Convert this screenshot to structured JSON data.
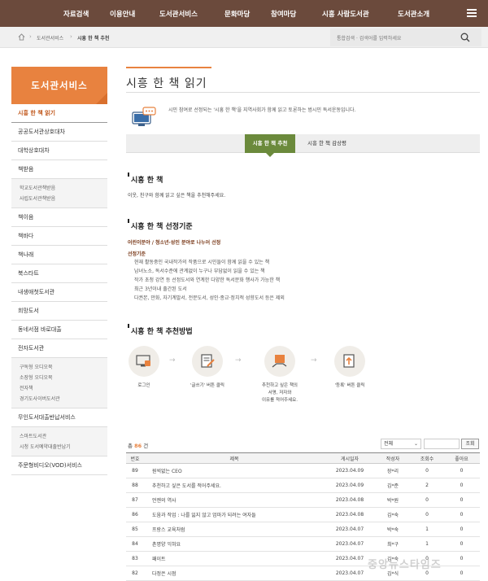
{
  "nav": {
    "items": [
      "자료검색",
      "이용안내",
      "도서관서비스",
      "문화마당",
      "참여마당",
      "시흥 사람도서관",
      "도서관소개"
    ]
  },
  "breadcrumb": {
    "items": [
      "도서관서비스",
      "시흥 한 책 추천"
    ]
  },
  "search": {
    "placeholder": "통합검색 · 검색어를 입력하세요"
  },
  "sidebar": {
    "title": "도서관서비스",
    "items": [
      {
        "label": "시흥 한 책 읽기",
        "active": true
      },
      {
        "label": "공공도서관상호대차"
      },
      {
        "label": "대학상호대차"
      },
      {
        "label": "책받음",
        "sub": [
          "학교도서관책받음",
          "사립도서관책받음"
        ]
      },
      {
        "label": "책이음"
      },
      {
        "label": "책바다"
      },
      {
        "label": "책나래"
      },
      {
        "label": "북스타트"
      },
      {
        "label": "내생애첫도서관"
      },
      {
        "label": "희망도서"
      },
      {
        "label": "동네서점 바로대출"
      },
      {
        "label": "전자도서관",
        "sub": [
          "구독형 오디오북",
          "소장형 오디오북",
          "전자책",
          "경기도사이버도서관"
        ]
      },
      {
        "label": "무인도서대출반납서비스",
        "sub": [
          "스마트도서관",
          "시청 도서예약대출반납기"
        ]
      },
      {
        "label": "주문형비디오(VOD)서비스"
      }
    ]
  },
  "main": {
    "title": "시흥 한 책 읽기",
    "intro": "시민 참여로 선정되는 '시흥 한 책'을 지역사회가 함께 읽고 토론하는 범시민 독서운동입니다.",
    "tabs": [
      "시흥 한 책 추천",
      "시흥 한 책 감상평"
    ],
    "section1": {
      "heading": "시흥 한 책",
      "text": "이웃, 친구와 함께 읽고 싶은 책을 추천해주세요."
    },
    "section2": {
      "heading": "시흥 한 책 선정기준",
      "subheading": "어린이분야 / 청소년·성인 분야로 나누어 선정",
      "criteria_label": "선정기준",
      "criteria": [
        "현재 활동중인 국내작가의 작품으로 시민들이 함께 읽을 수 있는 책",
        "남녀노소, 독서수준에 관계없이 누구나 부담없이 읽을 수 있는 책",
        "작가 초청 강연 등 선정도서와 연계한 다양한 독서문화 행사가 가능한 책",
        "최근 3년이내 출간된 도서",
        "다권본, 만화, 자기계발서, 전문도서, 성인·종교·정치적 성향도서 등은 제외"
      ]
    },
    "section3": {
      "heading": "시흥 한 책 추천방법",
      "steps": [
        {
          "label": "로그인",
          "icon": "login-monitor-icon"
        },
        {
          "label": "'글쓰기' 버튼 클릭",
          "icon": "write-document-icon"
        },
        {
          "label": "추천하고 싶은 책의\n서명, 저자와\n이유를 적어주세요.",
          "icon": "book-hand-icon"
        },
        {
          "label": "'등록' 버튼 클릭",
          "icon": "register-document-icon"
        }
      ]
    },
    "board": {
      "total_label": "총",
      "total_count": "86",
      "total_unit": "건",
      "select_value": "전체",
      "search_button": "조회",
      "columns": [
        "번호",
        "제목",
        "게시일자",
        "작성자",
        "조회수",
        "좋아요"
      ],
      "rows": [
        [
          "89",
          "원씩없는 CEO",
          "2023.04.09",
          "장*리",
          "0",
          "0"
        ],
        [
          "88",
          "추천하고 싶은 도서를 적어주세요.",
          "2023.04.09",
          "김*준",
          "2",
          "0"
        ],
        [
          "87",
          "언젠의 역사",
          "2023.04.08",
          "박*원",
          "0",
          "0"
        ],
        [
          "86",
          "도움과 작업 : 나를 잃지 않고 엄마가 되려는 여자들",
          "2023.04.08",
          "김*숙",
          "0",
          "0"
        ],
        [
          "85",
          "프랑스 교육처럼",
          "2023.04.07",
          "박*숙",
          "1",
          "0"
        ],
        [
          "84",
          "촌명양 익혀요",
          "2023.04.07",
          "최*구",
          "1",
          "0"
        ],
        [
          "83",
          "패이트",
          "2023.04.07",
          "김*숙",
          "0",
          "0"
        ],
        [
          "82",
          "다정은 시점",
          "2023.04.07",
          "김*식",
          "0",
          "0"
        ]
      ]
    }
  },
  "watermark": "중앙뉴스타임즈",
  "colors": {
    "nav": "#6b4a3c",
    "accent": "#e8823f",
    "tab_active": "#6b8a3c"
  }
}
